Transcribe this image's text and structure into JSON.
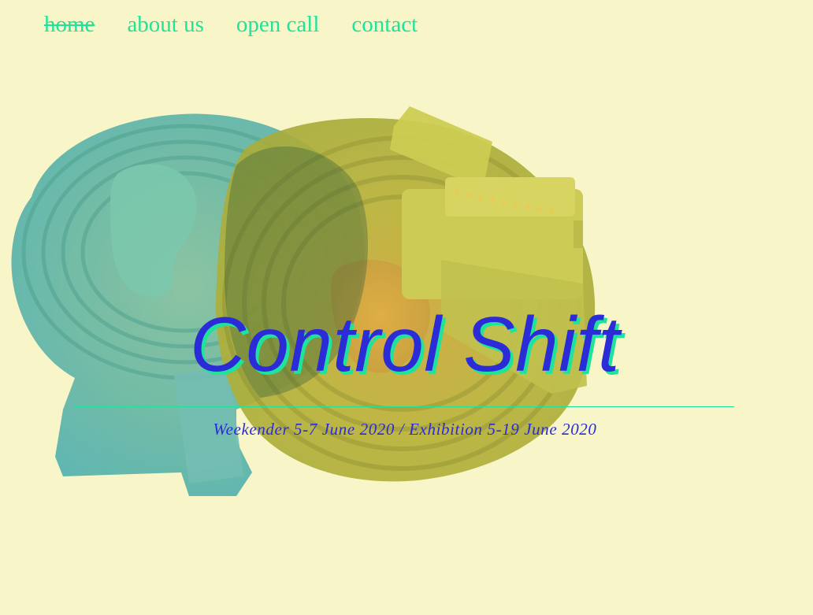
{
  "nav": {
    "items": [
      {
        "label": "home",
        "active": true
      },
      {
        "label": "about us",
        "active": false
      },
      {
        "label": "open call",
        "active": false
      },
      {
        "label": "contact",
        "active": false
      }
    ]
  },
  "hero": {
    "title": "Control Shift",
    "dates": "Weekender 5-7 June 2020 / Exhibition 5-19 June 2020"
  },
  "colors": {
    "background": "#f8f5c8",
    "accent_green": "#1fe39a",
    "accent_blue": "#2b2bd8"
  }
}
